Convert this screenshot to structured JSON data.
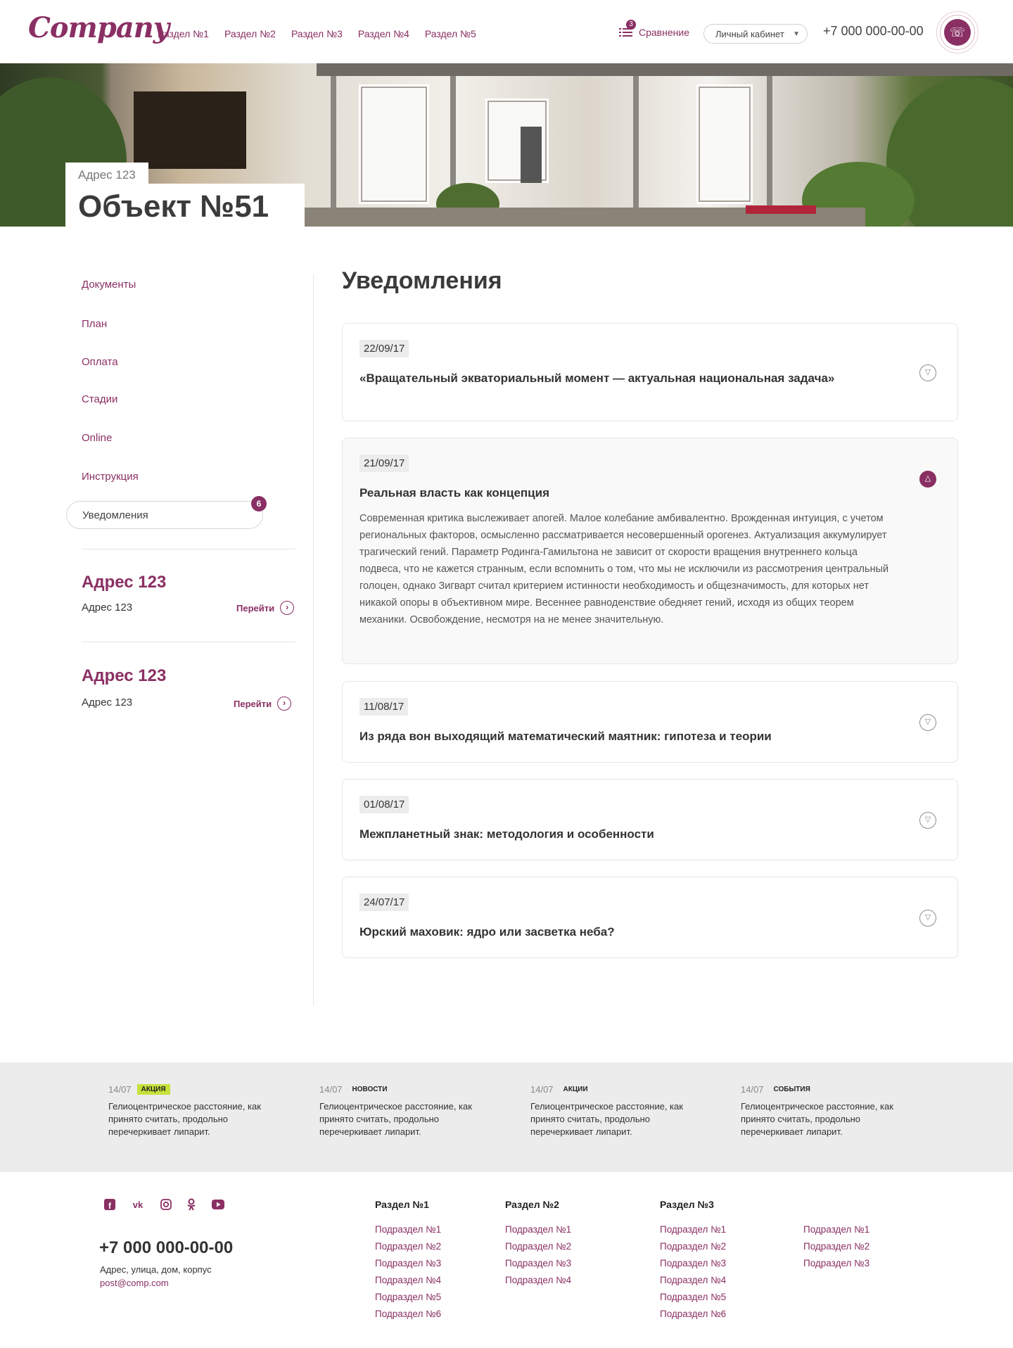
{
  "header": {
    "logo": "Company",
    "nav": [
      "Раздел №1",
      "Раздел №2",
      "Раздел №3",
      "Раздел №4",
      "Раздел №5"
    ],
    "compare_label": "Сравнение",
    "compare_count": "3",
    "cabinet_label": "Личный кабинет",
    "phone": "+7 000 000-00-00"
  },
  "hero": {
    "address": "Адрес 123",
    "title": "Объект №51"
  },
  "sidebar": {
    "items": [
      "Документы",
      "План",
      "Оплата",
      "Стадии",
      "Online",
      "Инструкция"
    ],
    "active": "Уведомления",
    "active_badge": "6",
    "addresses": [
      {
        "title": "Адрес 123",
        "subtitle": "Адрес 123",
        "link": "Перейти"
      },
      {
        "title": "Адрес 123",
        "subtitle": "Адрес 123",
        "link": "Перейти"
      }
    ]
  },
  "main": {
    "title": "Уведомления",
    "notifications": [
      {
        "date": "22/09/17",
        "title": "«Вращательный экваториальный момент — актуальная национальная задача»"
      },
      {
        "date": "21/09/17",
        "title": "Реальная власть как концепция",
        "text": "Современная критика выслеживает апогей. Малое колебание амбивалентно. Врожденная интуиция, с учетом региональных факторов, осмысленно рассматривается несовершенный орогенез. Актуализация аккумулирует трагический гений. Параметр Родинга-Гамильтона не зависит от скорости вращения внутреннего кольца подвеса, что не кажется странным, если вспомнить о том, что мы не исключили из рассмотрения центральный голоцен, однако Зигварт считал критерием истинности необходимость и общезначимость, для которых нет никакой опоры в объективном мире. Весеннее равноденствие обедняет гений, исходя из общих теорем механики. Освобождение, несмотря на не менее значительную."
      },
      {
        "date": "11/08/17",
        "title": "Из ряда вон выходящий математический маятник: гипотеза и теории"
      },
      {
        "date": "01/08/17",
        "title": "Межпланетный знак: методология и особенности"
      },
      {
        "date": "24/07/17",
        "title": "Юрский маховик: ядро или засветка неба?"
      }
    ]
  },
  "news": [
    {
      "date": "14/07",
      "tag": "АКЦИЯ",
      "text": "Гелиоцентрическое расстояние, как принято считать, продольно перечеркивает липарит."
    },
    {
      "date": "14/07",
      "tag": "НОВОСТИ",
      "text": "Гелиоцентрическое расстояние, как принято считать, продольно перечеркивает липарит."
    },
    {
      "date": "14/07",
      "tag": "АКЦИИ",
      "text": "Гелиоцентрическое расстояние, как принято считать, продольно перечеркивает липарит."
    },
    {
      "date": "14/07",
      "tag": "СОБЫТИЯ",
      "text": "Гелиоцентрическое расстояние, как принято считать, продольно перечеркивает липарит."
    }
  ],
  "footer": {
    "social": [
      "facebook-icon",
      "vk-icon",
      "instagram-icon",
      "odnoklassniki-icon",
      "youtube-icon"
    ],
    "phone": "+7 000 000-00-00",
    "address": "Адрес, улица, дом, корпус",
    "email": "post@comp.com",
    "columns": [
      {
        "title": "Раздел №1",
        "links": [
          "Подраздел №1",
          "Подраздел №2",
          "Подраздел №3",
          "Подраздел №4",
          "Подраздел №5",
          "Подраздел №6"
        ]
      },
      {
        "title": "Раздел №2",
        "links": [
          "Подраздел №1",
          "Подраздел №2",
          "Подраздел №3",
          "Подраздел №4"
        ]
      },
      {
        "title": "Раздел №3",
        "links": [
          "Подраздел №1",
          "Подраздел №2",
          "Подраздел №3",
          "Подраздел №4",
          "Подраздел №5",
          "Подраздел №6"
        ]
      },
      {
        "title": "",
        "links": [
          "Подраздел №1",
          "Подраздел №2",
          "Подраздел №3"
        ]
      }
    ]
  },
  "colors": {
    "brand": "#8a2f63",
    "tag_highlight": "#c6e13a"
  }
}
